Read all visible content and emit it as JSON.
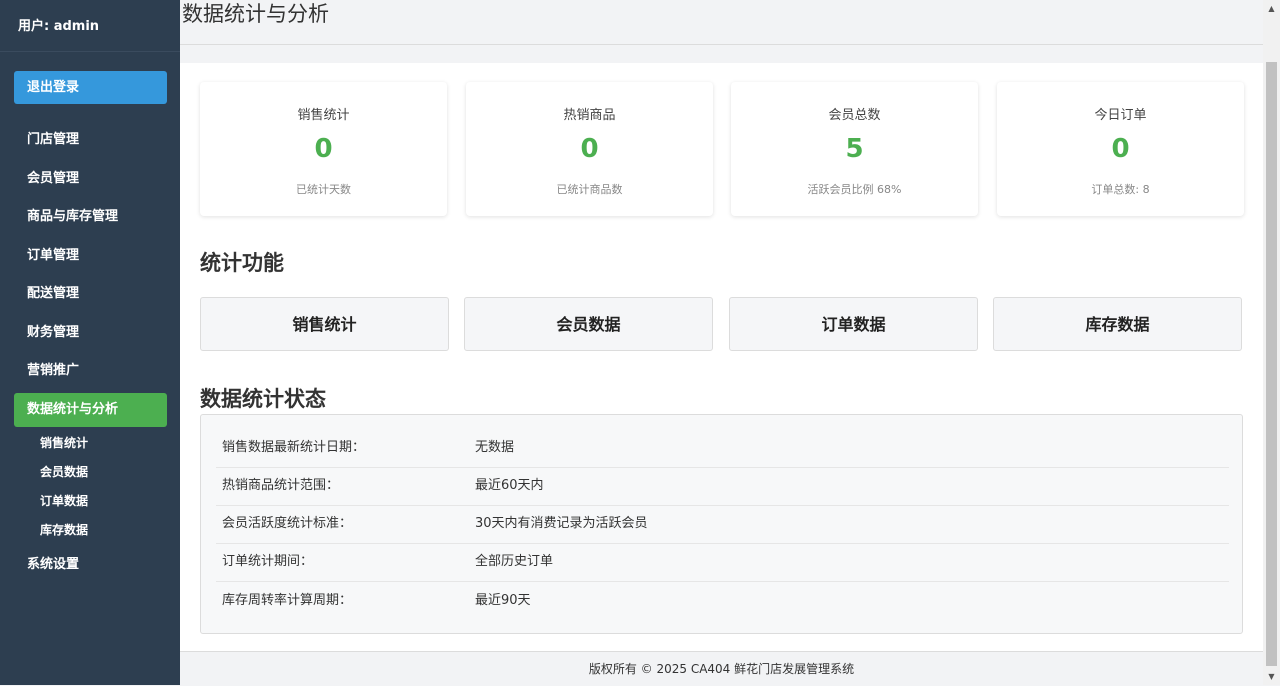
{
  "sidebar": {
    "user_label": "用户: admin",
    "logout_label": "退出登录",
    "items": [
      {
        "label": "门店管理"
      },
      {
        "label": "会员管理"
      },
      {
        "label": "商品与库存管理"
      },
      {
        "label": "订单管理"
      },
      {
        "label": "配送管理"
      },
      {
        "label": "财务管理"
      },
      {
        "label": "营销推广"
      },
      {
        "label": "数据统计与分析"
      }
    ],
    "subitems": [
      {
        "label": "销售统计"
      },
      {
        "label": "会员数据"
      },
      {
        "label": "订单数据"
      },
      {
        "label": "库存数据"
      }
    ],
    "settings_label": "系统设置"
  },
  "page": {
    "title": "数据统计与分析"
  },
  "stats": [
    {
      "label": "销售统计",
      "value": "0",
      "sub": "已统计天数"
    },
    {
      "label": "热销商品",
      "value": "0",
      "sub": "已统计商品数"
    },
    {
      "label": "会员总数",
      "value": "5",
      "sub": "活跃会员比例 68%"
    },
    {
      "label": "今日订单",
      "value": "0",
      "sub": "订单总数: 8"
    }
  ],
  "functions": {
    "title": "统计功能",
    "buttons": [
      {
        "label": "销售统计"
      },
      {
        "label": "会员数据"
      },
      {
        "label": "订单数据"
      },
      {
        "label": "库存数据"
      }
    ]
  },
  "status": {
    "title": "数据统计状态",
    "rows": [
      {
        "key": "销售数据最新统计日期：",
        "value": "无数据"
      },
      {
        "key": "热销商品统计范围：",
        "value": "最近60天内"
      },
      {
        "key": "会员活跃度统计标准：",
        "value": "30天内有消费记录为活跃会员"
      },
      {
        "key": "订单统计期间：",
        "value": "全部历史订单"
      },
      {
        "key": "库存周转率计算周期：",
        "value": "最近90天"
      }
    ]
  },
  "footer": {
    "text": "版权所有 © 2025 CA404 鲜花门店发展管理系统"
  },
  "colors": {
    "sidebar_bg": "#2d3e50",
    "logout_btn": "#3598dc",
    "active_item": "#4caf50",
    "stat_value": "#4caf50"
  }
}
